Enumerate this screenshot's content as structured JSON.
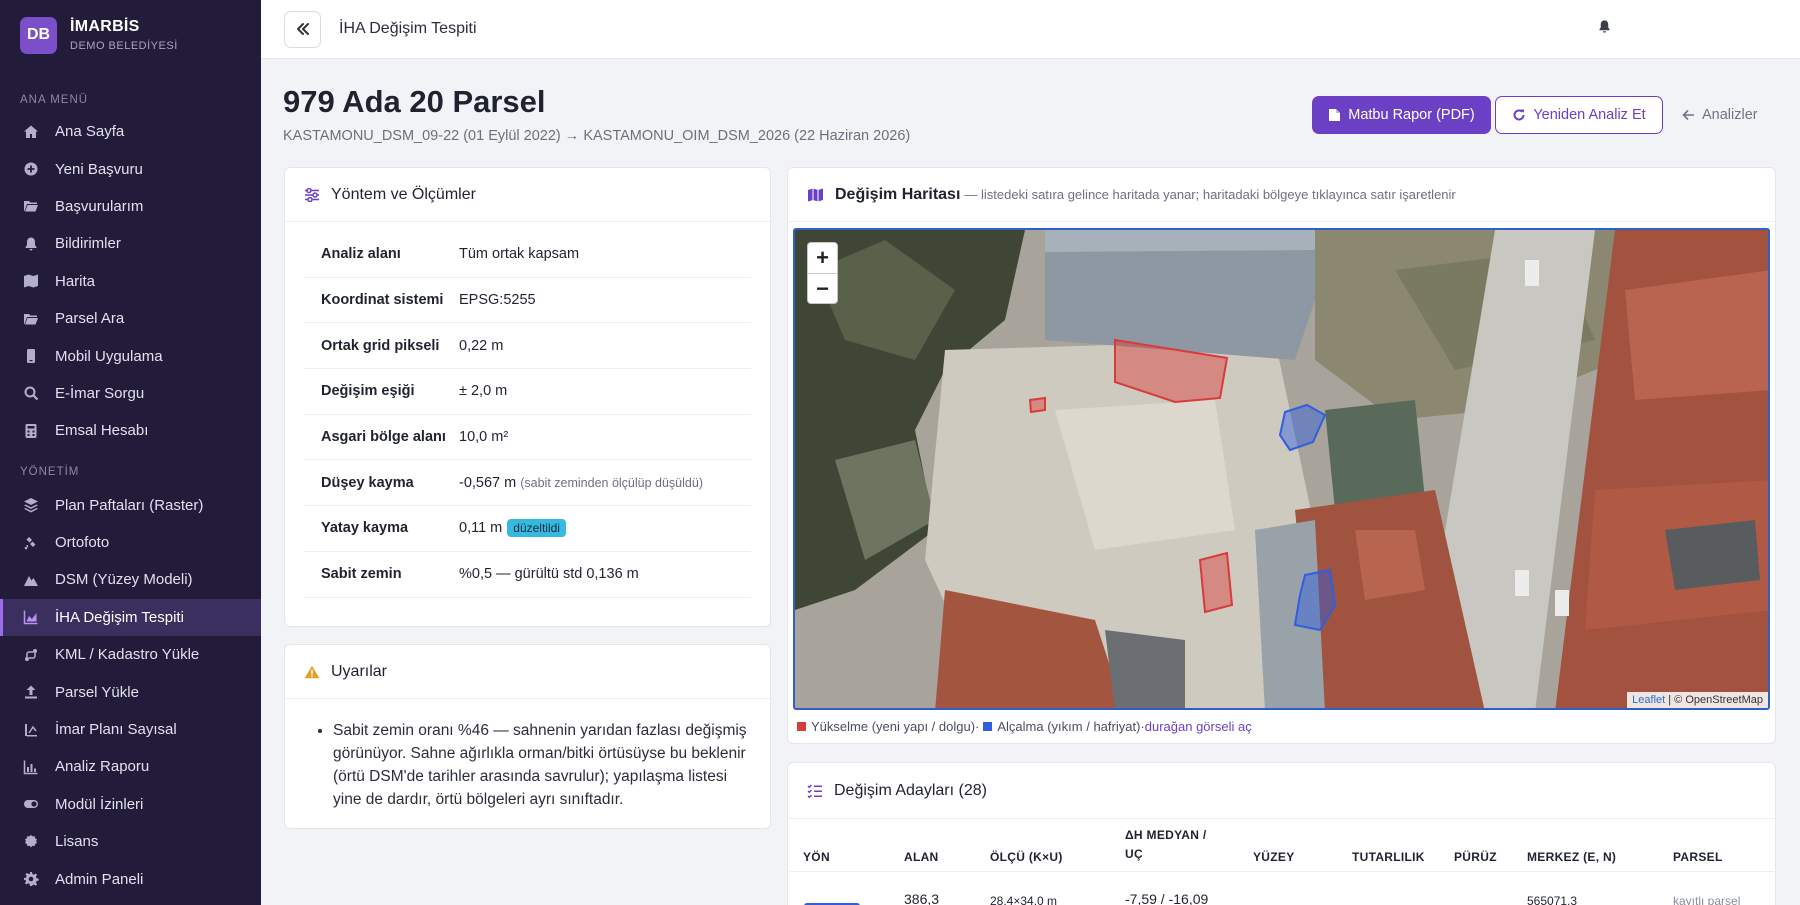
{
  "brand": {
    "logo": "DB",
    "name": "İMARBİS",
    "subtitle": "DEMO BELEDİYESİ"
  },
  "sidebar": {
    "section_main": "ANA MENÜ",
    "main_items": [
      {
        "label": "Ana Sayfa",
        "icon": "home-icon"
      },
      {
        "label": "Yeni Başvuru",
        "icon": "plus-circle-icon"
      },
      {
        "label": "Başvurularım",
        "icon": "folder-open-icon"
      },
      {
        "label": "Bildirimler",
        "icon": "bell-icon"
      },
      {
        "label": "Harita",
        "icon": "map-icon"
      },
      {
        "label": "Parsel Ara",
        "icon": "folder-search-icon"
      },
      {
        "label": "Mobil Uygulama",
        "icon": "mobile-icon"
      },
      {
        "label": "E-İmar Sorgu",
        "icon": "search-icon"
      },
      {
        "label": "Emsal Hesabı",
        "icon": "calculator-icon"
      }
    ],
    "section_admin": "YÖNETİM",
    "admin_items": [
      {
        "label": "Plan Paftaları (Raster)",
        "icon": "layers-icon"
      },
      {
        "label": "Ortofoto",
        "icon": "satellite-icon"
      },
      {
        "label": "DSM (Yüzey Modeli)",
        "icon": "mountain-icon"
      },
      {
        "label": "İHA Değişim Tespiti",
        "icon": "chart-area-icon",
        "active": true
      },
      {
        "label": "KML / Kadastro Yükle",
        "icon": "route-icon"
      },
      {
        "label": "Parsel Yükle",
        "icon": "upload-icon"
      },
      {
        "label": "İmar Planı Sayısal",
        "icon": "ruler-icon"
      },
      {
        "label": "Analiz Raporu",
        "icon": "chart-line-icon"
      },
      {
        "label": "Modül İzinleri",
        "icon": "toggle-icon"
      },
      {
        "label": "Lisans",
        "icon": "certificate-icon"
      },
      {
        "label": "Admin Paneli",
        "icon": "gear-icon"
      }
    ]
  },
  "topbar": {
    "title": "İHA Değişim Tespiti"
  },
  "header": {
    "title": "979 Ada 20 Parsel",
    "subtitle": "KASTAMONU_DSM_09-22 (01 Eylül 2022) → KASTAMONU_OIM_DSM_2026 (22 Haziran 2026)",
    "btn_pdf": "Matbu Rapor (PDF)",
    "btn_reanalyze": "Yeniden Analiz Et",
    "btn_back": "Analizler"
  },
  "method": {
    "title": "Yöntem ve Ölçümler",
    "rows": [
      {
        "key": "Analiz alanı",
        "value": "Tüm ortak kapsam"
      },
      {
        "key": "Koordinat sistemi",
        "value": "EPSG:5255"
      },
      {
        "key": "Ortak grid pikseli",
        "value": "0,22 m"
      },
      {
        "key": "Değişim eşiği",
        "value": "± 2,0 m"
      },
      {
        "key": "Asgari bölge alanı",
        "value": "10,0 m²"
      },
      {
        "key": "Düşey kayma",
        "value": "-0,567 m",
        "note": "(sabit zeminden ölçülüp düşüldü)"
      },
      {
        "key": "Yatay kayma",
        "value": "0,11 m",
        "badge": "düzeltildi"
      },
      {
        "key": "Sabit zemin",
        "value": "%0,5 — gürültü std 0,136 m"
      }
    ]
  },
  "warnings": {
    "title": "Uyarılar",
    "items": [
      "Sabit zemin oranı %46 — sahnenin yarıdan fazlası değişmiş görünüyor. Sahne ağırlıkla orman/bitki örtüsüyse bu beklenir (örtü DSM'de tarihler arasında savrulur); yapılaşma listesi yine de dardır, örtü bölgeleri ayrı sınıftadır."
    ]
  },
  "map": {
    "title": "Değişim Haritası",
    "note": "— listedeki satıra gelince haritada yanar; haritadaki bölgeye tıklayınca satır işaretlenir",
    "zoom_in": "+",
    "zoom_out": "−",
    "attribution_leaflet": "Leaflet",
    "attribution_osm": "| © OpenStreetMap",
    "legend_up": "Yükselme (yeni yapı / dolgu)",
    "legend_sep": " · ",
    "legend_down": "Alçalma (yıkım / hafriyat)",
    "legend_link": "durağan görseli aç",
    "color_up": "#d93a3a",
    "color_down": "#2f5ee0"
  },
  "candidates": {
    "title": "Değişim Adayları (28)",
    "columns": [
      "YÖN",
      "ALAN",
      "ÖLÇÜ (K×U)",
      "ΔH MEDYAN / UÇ",
      "YÜZEY",
      "TUTARLILIK",
      "PÜRÜZ",
      "MERKEZ (E, N)",
      "PARSEL"
    ],
    "first_row": {
      "alan": "386,3",
      "olcu": "28,4×34,0 m",
      "dh": "-7,59 / -16,09",
      "merkez": "565071,3",
      "parsel": "kayıtlı parsel"
    }
  }
}
